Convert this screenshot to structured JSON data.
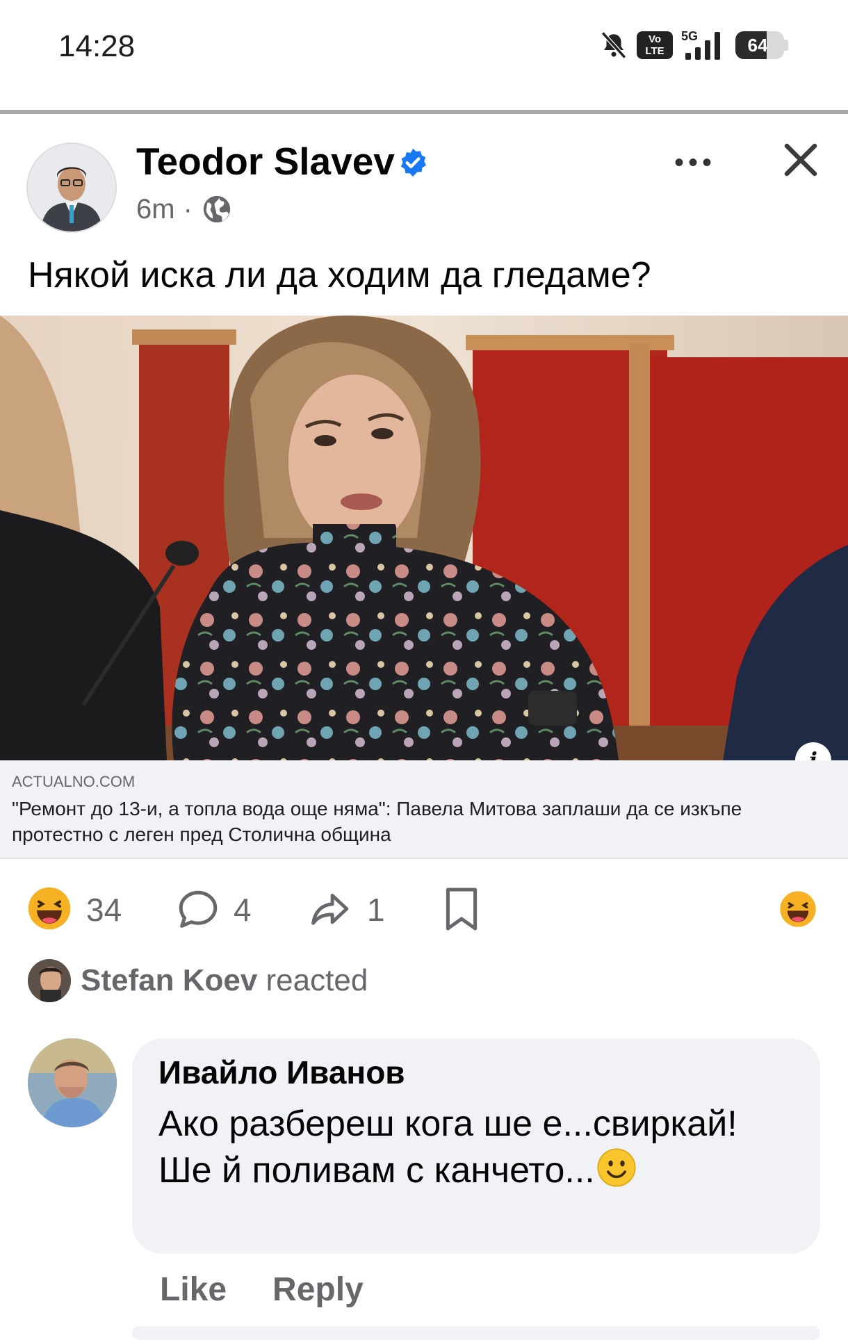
{
  "status_bar": {
    "time": "14:28",
    "network": "5G",
    "volte_label": "Vo\nLTE",
    "battery_percent": 64,
    "battery_label": "64",
    "icons": [
      "bell-muted-icon",
      "volte-icon",
      "signal-icon",
      "battery-icon"
    ]
  },
  "post": {
    "author": "Teodor Slavev",
    "verified": true,
    "time": "6m",
    "separator": "·",
    "audience_icon": "globe-icon",
    "more_label": "•••",
    "text": "Някой иска ли да ходим да гледаме?",
    "link": {
      "domain": "ACTUALNO.COM",
      "title": "\"Ремонт до 13-и, а топла вода още няма\": Павела Митова заплаши да се изкъпе протестно с леген пред Столична община",
      "info_label": "i"
    },
    "stats": {
      "reactions": "34",
      "comments": "4",
      "shares": "1"
    },
    "reacted": {
      "name": "Stefan Koev",
      "verb": "reacted"
    }
  },
  "comment": {
    "author": "Ивайло Иванов",
    "text": "Ако разбереш кога ше е...свиркай!\nШе й поливам с канчето...",
    "emoji_icon": "smiley-icon",
    "like_label": "Like",
    "reply_label": "Reply"
  },
  "colors": {
    "verified_blue": "#1877f2",
    "secondary_text": "#65676b",
    "bubble_bg": "#f0f2f5",
    "haha_yellow": "#f7b125"
  }
}
